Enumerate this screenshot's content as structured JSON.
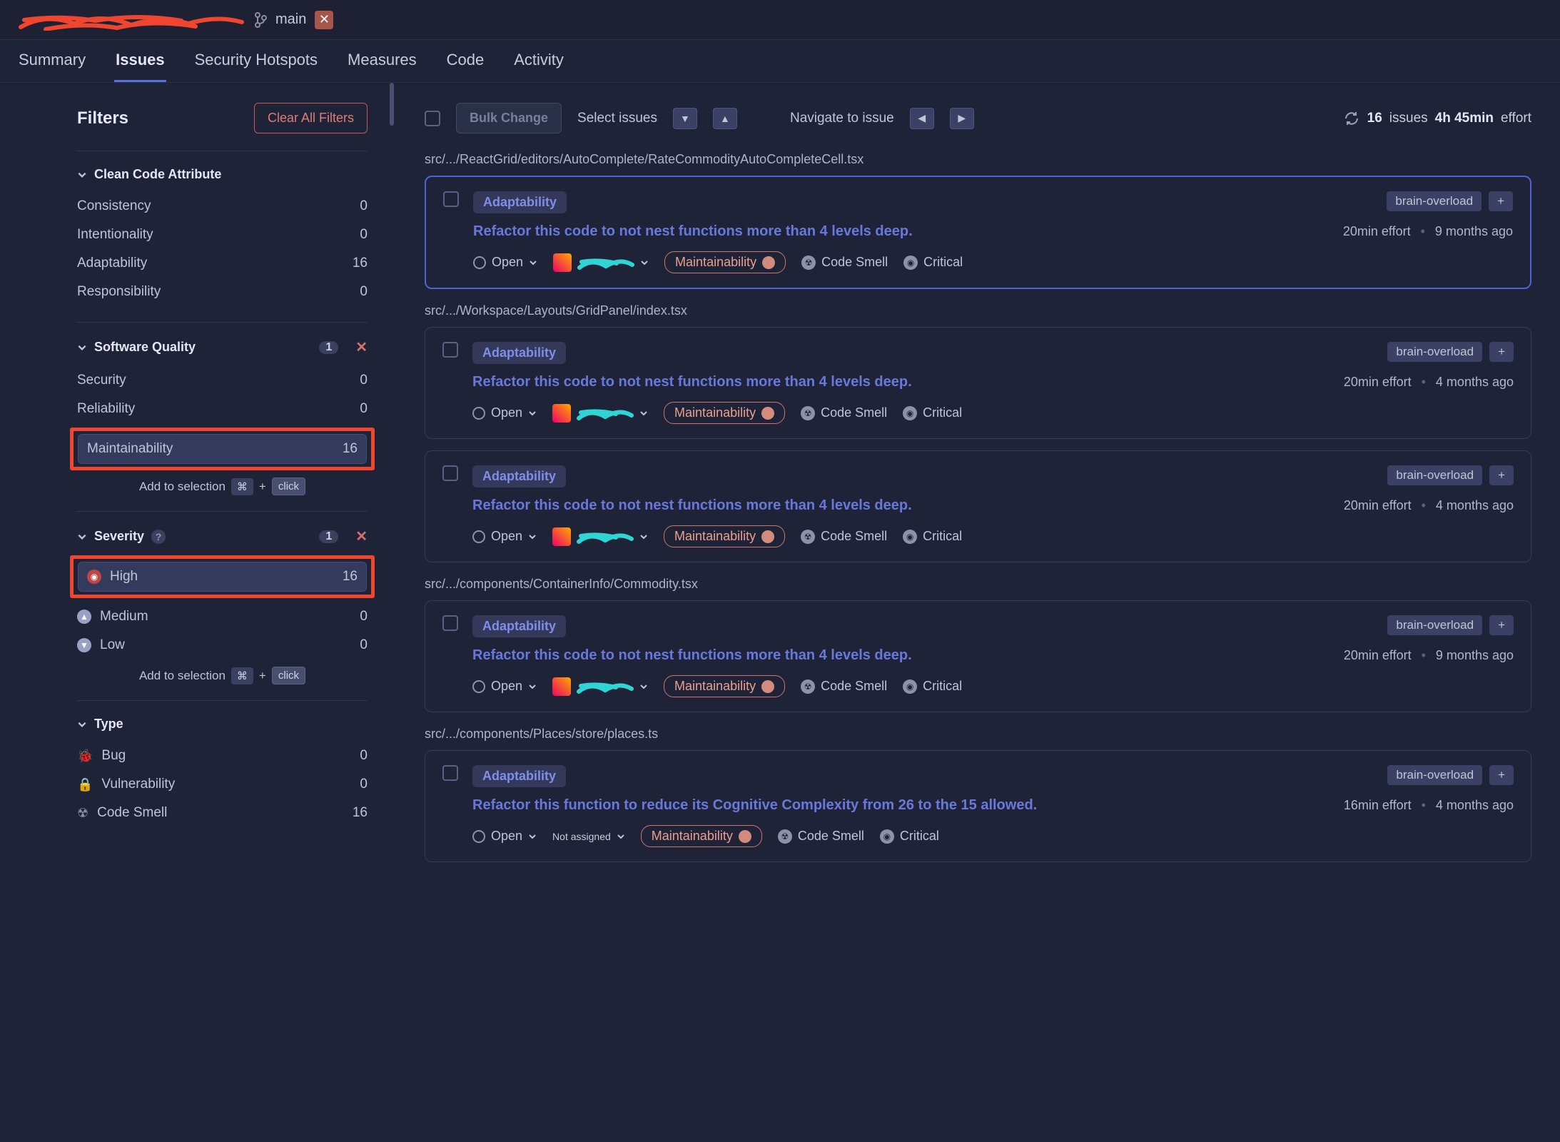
{
  "topbar": {
    "branch": "main"
  },
  "nav": {
    "summary": "Summary",
    "issues": "Issues",
    "hotspots": "Security Hotspots",
    "measures": "Measures",
    "code": "Code",
    "activity": "Activity"
  },
  "sidebar": {
    "title": "Filters",
    "clear": "Clear All Filters",
    "addSelection": "Add to selection",
    "kbdCmd": "⌘",
    "kbdPlus": "+",
    "kbdClick": "click",
    "sections": {
      "cleanCode": {
        "title": "Clean Code Attribute",
        "items": [
          {
            "label": "Consistency",
            "count": "0"
          },
          {
            "label": "Intentionality",
            "count": "0"
          },
          {
            "label": "Adaptability",
            "count": "16"
          },
          {
            "label": "Responsibility",
            "count": "0"
          }
        ]
      },
      "quality": {
        "title": "Software Quality",
        "badge": "1",
        "items": [
          {
            "label": "Security",
            "count": "0"
          },
          {
            "label": "Reliability",
            "count": "0"
          },
          {
            "label": "Maintainability",
            "count": "16",
            "selected": true
          }
        ]
      },
      "severity": {
        "title": "Severity",
        "badge": "1",
        "items": [
          {
            "label": "High",
            "count": "16",
            "selected": true,
            "sev": "high"
          },
          {
            "label": "Medium",
            "count": "0",
            "sev": "med"
          },
          {
            "label": "Low",
            "count": "0",
            "sev": "low"
          }
        ]
      },
      "type": {
        "title": "Type",
        "items": [
          {
            "label": "Bug",
            "count": "0"
          },
          {
            "label": "Vulnerability",
            "count": "0"
          },
          {
            "label": "Code Smell",
            "count": "16"
          }
        ]
      }
    }
  },
  "toolbar": {
    "bulk": "Bulk Change",
    "select": "Select issues",
    "navigate": "Navigate to issue",
    "issueCount": "16",
    "issuesLabel": "issues",
    "effort": "4h 45min",
    "effortLabel": "effort"
  },
  "common": {
    "adaptTag": "Adaptability",
    "open": "Open",
    "maintainability": "Maintainability",
    "codeSmell": "Code Smell",
    "critical": "Critical",
    "notAssigned": "Not assigned",
    "brainOverload": "brain-overload",
    "plus": "+"
  },
  "groups": [
    {
      "path": "src/.../ReactGrid/editors/AutoComplete/RateCommodityAutoCompleteCell.tsx",
      "issues": [
        {
          "title": "Refactor this code to not nest functions more than 4 levels deep.",
          "effort": "20min effort",
          "age": "9 months ago",
          "selected": true,
          "assignee": true
        }
      ]
    },
    {
      "path": "src/.../Workspace/Layouts/GridPanel/index.tsx",
      "issues": [
        {
          "title": "Refactor this code to not nest functions more than 4 levels deep.",
          "effort": "20min effort",
          "age": "4 months ago",
          "assignee": true
        },
        {
          "title": "Refactor this code to not nest functions more than 4 levels deep.",
          "effort": "20min effort",
          "age": "4 months ago",
          "assignee": true
        }
      ]
    },
    {
      "path": "src/.../components/ContainerInfo/Commodity.tsx",
      "issues": [
        {
          "title": "Refactor this code to not nest functions more than 4 levels deep.",
          "effort": "20min effort",
          "age": "9 months ago",
          "assignee": true
        }
      ]
    },
    {
      "path": "src/.../components/Places/store/places.ts",
      "issues": [
        {
          "title": "Refactor this function to reduce its Cognitive Complexity from 26 to the 15 allowed.",
          "effort": "16min effort",
          "age": "4 months ago",
          "assignee": false
        }
      ]
    }
  ]
}
